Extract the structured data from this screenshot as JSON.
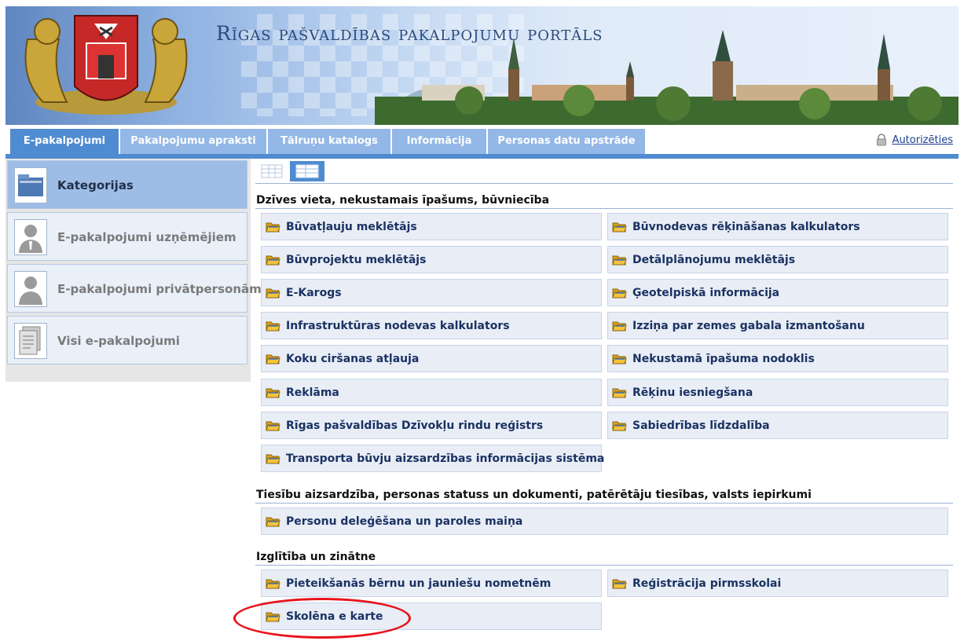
{
  "header": {
    "title": "Rīgas pašvaldības pakalpojumu portāls"
  },
  "nav": {
    "tabs": [
      {
        "label": "E-pakalpojumi",
        "active": true
      },
      {
        "label": "Pakalpojumu apraksti",
        "active": false
      },
      {
        "label": "Tālruņu katalogs",
        "active": false
      },
      {
        "label": "Informācija",
        "active": false
      },
      {
        "label": "Personas datu apstrāde",
        "active": false
      }
    ],
    "auth_label": "Autorizēties",
    "auth_icon": "lock-icon"
  },
  "sidebar": {
    "items": [
      {
        "label": "Kategorijas",
        "icon": "folder-icon",
        "active": true
      },
      {
        "label": "E-pakalpojumi uzņēmējiem",
        "icon": "business-person-icon",
        "active": false
      },
      {
        "label": "E-pakalpojumi privātpersonām",
        "icon": "person-icon",
        "active": false
      },
      {
        "label": "Visi e-pakalpojumi",
        "icon": "documents-icon",
        "active": false
      }
    ]
  },
  "view_toggles": [
    "grid-view-icon",
    "list-view-icon"
  ],
  "sections": [
    {
      "title": "Dzīves vieta, nekustamais īpašums, būvniecība",
      "items": [
        "Būvatļauju meklētājs",
        "Būvnodevas rēķināšanas kalkulators",
        "Būvprojektu meklētājs",
        "Detālplānojumu meklētājs",
        "E-Karogs",
        "Ģeotelpiskā informācija",
        "Infrastruktūras nodevas kalkulators",
        "Izziņa par zemes gabala izmantošanu",
        "Koku ciršanas atļauja",
        "Nekustamā īpašuma nodoklis",
        "Reklāma",
        "Rēķinu iesniegšana",
        "Rīgas pašvaldības Dzīvokļu rindu reģistrs",
        "Sabiedrības līdzdalība",
        "Transporta būvju aizsardzības informācijas sistēma"
      ]
    },
    {
      "title": "Tiesību aizsardzība, personas statuss un dokumenti, patērētāju tiesības, valsts iepirkumi",
      "items": [
        "Personu deleģēšana un paroles maiņa"
      ]
    },
    {
      "title": "Izglītība un zinātne",
      "items": [
        "Pieteikšanās bērnu un jauniešu nometnēm",
        "Reģistrācija pirmsskolai",
        "Skolēna e karte"
      ]
    }
  ],
  "colors": {
    "accent": "#4f8bd0",
    "tab_inactive": "#93b7e6",
    "item_bg": "#e8edf6",
    "item_text": "#1b3262",
    "highlight_circle": "#e8141c"
  }
}
